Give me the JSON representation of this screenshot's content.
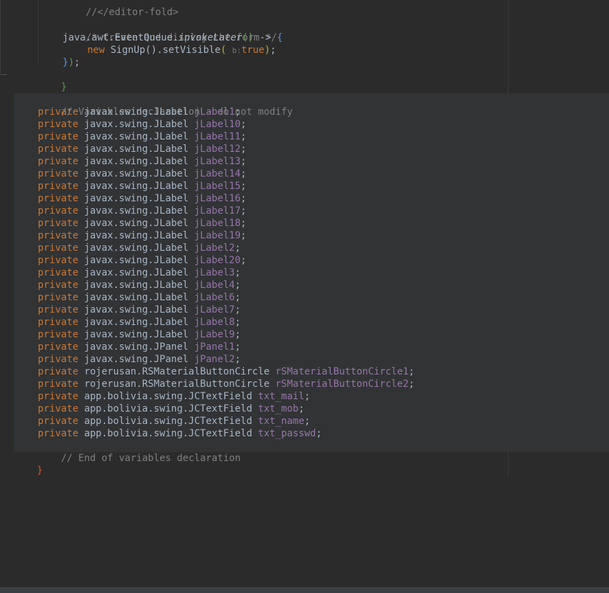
{
  "colors": {
    "background": "#2b2b2b",
    "keyword": "#cc7832",
    "comment": "#808080",
    "field": "#9876aa",
    "text": "#a9b7c6"
  },
  "code": {
    "top": {
      "fold_comment": "//</editor-fold>",
      "comment_create": "/* Create and display the form */",
      "invoke_prefix": "java.awt.EventQueue.",
      "invoke_method": "invokeLater",
      "lambda_open": "()",
      "arrow": " -> ",
      "brace_open": "{",
      "new_kw": "new",
      "new_call": " SignUp().setVisible",
      "param_hint": "b:",
      "true_kw": "true",
      "call_end": ");",
      "lambda_close_brace": "}",
      "lambda_close_paren": ")",
      "lambda_semi": ";",
      "method_close": "}"
    },
    "var_comment_start": "// Variables declaration - do not modify",
    "var_comment_end": "// End of variables declaration",
    "class_close": "}",
    "declarations": [
      {
        "modifier": "private",
        "type": "javax.swing.JLabel",
        "name": "jLabel1"
      },
      {
        "modifier": "private",
        "type": "javax.swing.JLabel",
        "name": "jLabel10"
      },
      {
        "modifier": "private",
        "type": "javax.swing.JLabel",
        "name": "jLabel11"
      },
      {
        "modifier": "private",
        "type": "javax.swing.JLabel",
        "name": "jLabel12"
      },
      {
        "modifier": "private",
        "type": "javax.swing.JLabel",
        "name": "jLabel13"
      },
      {
        "modifier": "private",
        "type": "javax.swing.JLabel",
        "name": "jLabel14"
      },
      {
        "modifier": "private",
        "type": "javax.swing.JLabel",
        "name": "jLabel15"
      },
      {
        "modifier": "private",
        "type": "javax.swing.JLabel",
        "name": "jLabel16"
      },
      {
        "modifier": "private",
        "type": "javax.swing.JLabel",
        "name": "jLabel17"
      },
      {
        "modifier": "private",
        "type": "javax.swing.JLabel",
        "name": "jLabel18"
      },
      {
        "modifier": "private",
        "type": "javax.swing.JLabel",
        "name": "jLabel19"
      },
      {
        "modifier": "private",
        "type": "javax.swing.JLabel",
        "name": "jLabel2"
      },
      {
        "modifier": "private",
        "type": "javax.swing.JLabel",
        "name": "jLabel20"
      },
      {
        "modifier": "private",
        "type": "javax.swing.JLabel",
        "name": "jLabel3"
      },
      {
        "modifier": "private",
        "type": "javax.swing.JLabel",
        "name": "jLabel4"
      },
      {
        "modifier": "private",
        "type": "javax.swing.JLabel",
        "name": "jLabel6"
      },
      {
        "modifier": "private",
        "type": "javax.swing.JLabel",
        "name": "jLabel7"
      },
      {
        "modifier": "private",
        "type": "javax.swing.JLabel",
        "name": "jLabel8"
      },
      {
        "modifier": "private",
        "type": "javax.swing.JLabel",
        "name": "jLabel9"
      },
      {
        "modifier": "private",
        "type": "javax.swing.JPanel",
        "name": "jPanel1"
      },
      {
        "modifier": "private",
        "type": "javax.swing.JPanel",
        "name": "jPanel2"
      },
      {
        "modifier": "private",
        "type": "rojerusan.RSMaterialButtonCircle",
        "name": "rSMaterialButtonCircle1"
      },
      {
        "modifier": "private",
        "type": "rojerusan.RSMaterialButtonCircle",
        "name": "rSMaterialButtonCircle2"
      },
      {
        "modifier": "private",
        "type": "app.bolivia.swing.JCTextField",
        "name": "txt_mail"
      },
      {
        "modifier": "private",
        "type": "app.bolivia.swing.JCTextField",
        "name": "txt_mob"
      },
      {
        "modifier": "private",
        "type": "app.bolivia.swing.JCTextField",
        "name": "txt_name"
      },
      {
        "modifier": "private",
        "type": "app.bolivia.swing.JCTextField",
        "name": "txt_passwd"
      }
    ]
  }
}
